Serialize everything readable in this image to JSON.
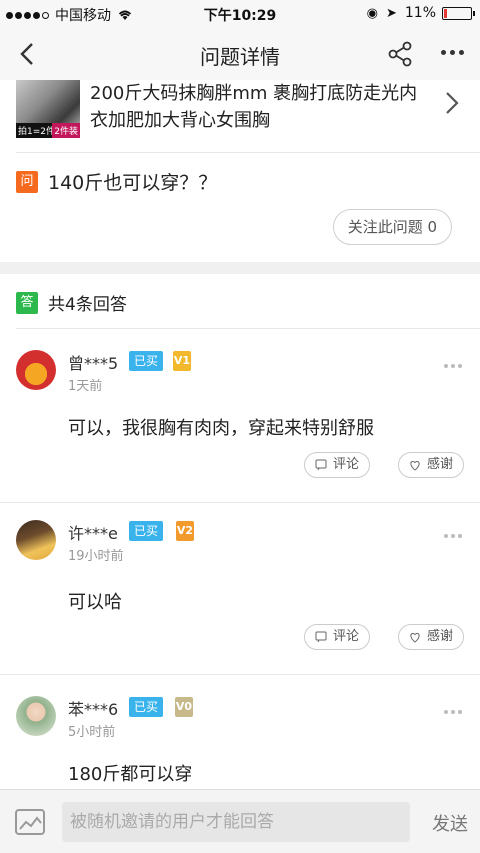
{
  "status_bar": {
    "carrier": "中国移动",
    "time": "下午10:29",
    "battery": "11%",
    "battery_level": 0.11
  },
  "nav": {
    "title": "问题详情"
  },
  "product": {
    "title": "200斤大码抹胸胖mm 裹胸打底防走光内衣加肥加大背心女围胸",
    "thumb_tag_left": "拍1=2件",
    "thumb_tag_right": "2件装"
  },
  "question": {
    "badge": "问",
    "text": "140斤也可以穿？？",
    "follow_label": "关注此问题 0"
  },
  "answers_header": {
    "badge": "答",
    "count_text": "共4条回答"
  },
  "answers": [
    {
      "user": "曾***5",
      "bought": "已买",
      "level": "V1",
      "time": "1天前",
      "text": "可以，我很胸有肉肉，穿起来特别舒服",
      "comment": "评论",
      "thanks": "感谢",
      "level_color": "#f2b92c"
    },
    {
      "user": "许***e",
      "bought": "已买",
      "level": "V2",
      "time": "19小时前",
      "text": "可以哈",
      "comment": "评论",
      "thanks": "感谢",
      "level_color": "#f29a2c"
    },
    {
      "user": "苯***6",
      "bought": "已买",
      "level": "V0",
      "time": "5小时前",
      "text": "180斤都可以穿",
      "level_color": "#c8b98a"
    }
  ],
  "input_bar": {
    "placeholder": "被随机邀请的用户才能回答",
    "send_label": "发送"
  }
}
